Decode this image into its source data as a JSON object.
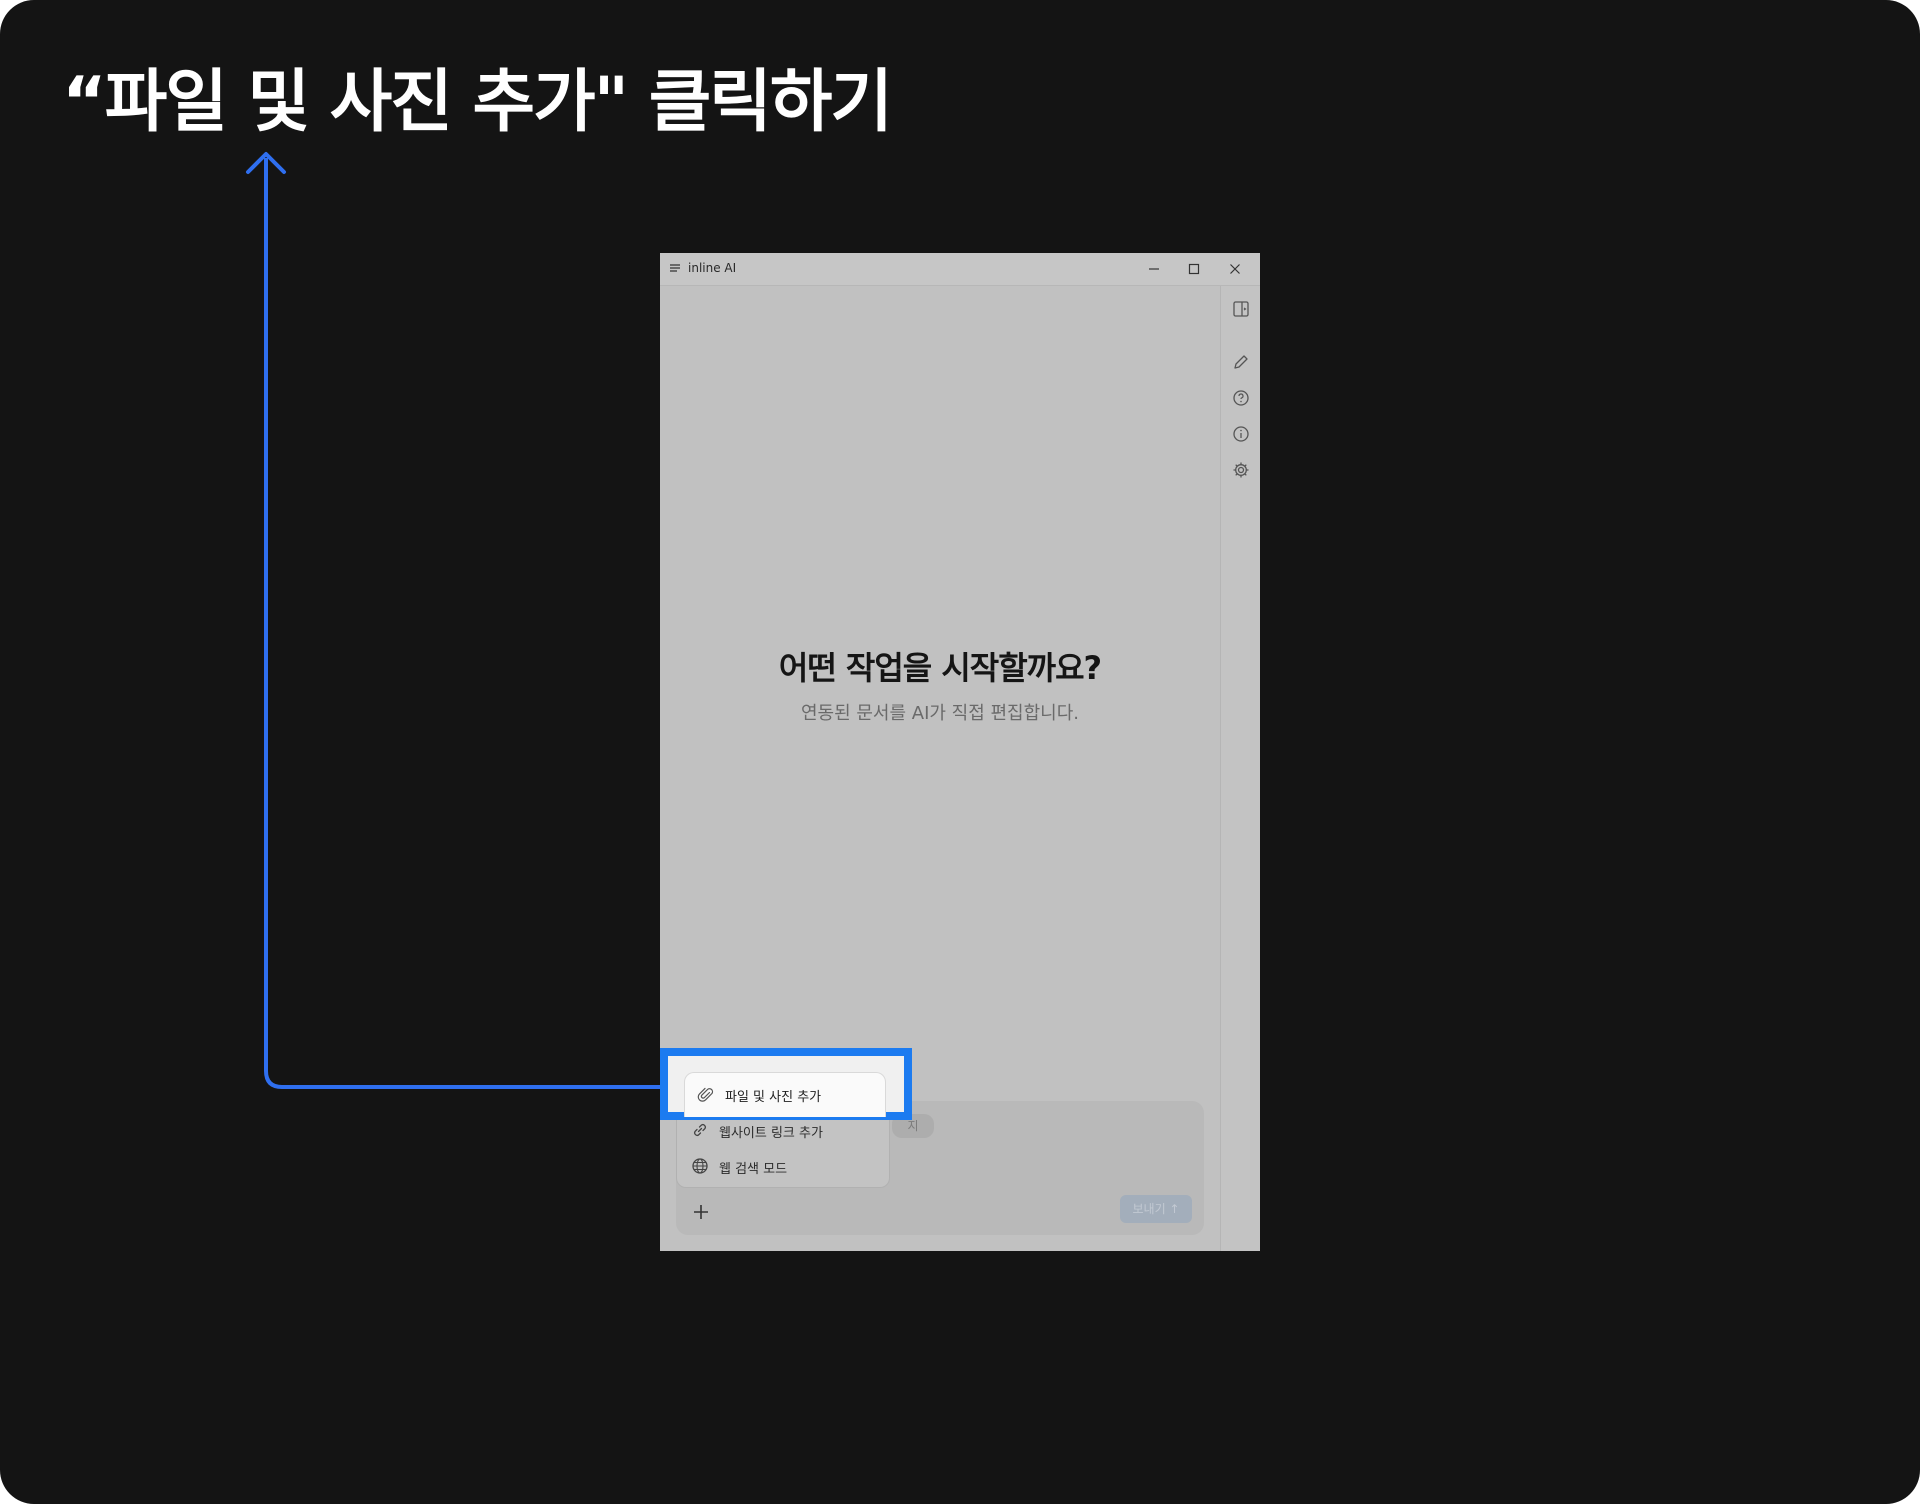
{
  "headline": "“파일 및 사진 추가\" 클릭하기",
  "colors": {
    "background": "#141414",
    "accent": "#1c7bf0",
    "window": "#c1c1c1"
  },
  "window": {
    "title": "inline AI",
    "icons": {
      "menu": "hamburger-icon",
      "minimize": "minimize-icon",
      "maximize": "maximize-icon",
      "close": "close-icon"
    }
  },
  "sidebar": {
    "icons": [
      "panel-toggle-icon",
      "pencil-icon",
      "help-circle-icon",
      "info-circle-icon",
      "gear-icon"
    ]
  },
  "main": {
    "heading": "어떤 작업을 시작할까요?",
    "subheading": "연동된 문서를 AI가 직접 편집합니다."
  },
  "attach_menu": {
    "items": [
      {
        "label": "파일 및 사진 추가",
        "icon": "paperclip-icon"
      },
      {
        "label": "웹사이트 링크 추가",
        "icon": "link-icon"
      },
      {
        "label": "웹 검색 모드",
        "icon": "globe-icon"
      }
    ]
  },
  "composer": {
    "chip_label": "지",
    "plus_icon": "plus-icon",
    "send_label": "보내기",
    "send_icon": "arrow-up-icon"
  }
}
